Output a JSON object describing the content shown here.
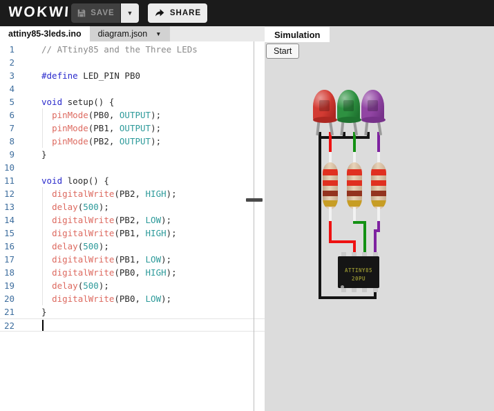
{
  "topbar": {
    "logo": "WOKWI",
    "save_label": "SAVE",
    "share_label": "SHARE"
  },
  "tabs": {
    "file_tab": "attiny85-3leds.ino",
    "diagram_tab": "diagram.json"
  },
  "simulation": {
    "tab_label": "Simulation",
    "start_label": "Start"
  },
  "editor": {
    "cursor": {
      "line": 22,
      "column": 0
    },
    "lines": [
      {
        "n": 1,
        "g": false,
        "tokens": [
          [
            "cm",
            "// ATtiny85 and the Three LEDs"
          ]
        ]
      },
      {
        "n": 2,
        "g": false,
        "tokens": []
      },
      {
        "n": 3,
        "g": false,
        "tokens": [
          [
            "kw",
            "#define"
          ],
          [
            "pl",
            " LED_PIN PB0"
          ]
        ]
      },
      {
        "n": 4,
        "g": false,
        "tokens": []
      },
      {
        "n": 5,
        "g": false,
        "tokens": [
          [
            "kw",
            "void"
          ],
          [
            "pl",
            " setup() {"
          ]
        ]
      },
      {
        "n": 6,
        "g": true,
        "tokens": [
          [
            "pl",
            "  "
          ],
          [
            "fn",
            "pinMode"
          ],
          [
            "pl",
            "(PB0, "
          ],
          [
            "ct",
            "OUTPUT"
          ],
          [
            "pl",
            ");"
          ]
        ]
      },
      {
        "n": 7,
        "g": true,
        "tokens": [
          [
            "pl",
            "  "
          ],
          [
            "fn",
            "pinMode"
          ],
          [
            "pl",
            "(PB1, "
          ],
          [
            "ct",
            "OUTPUT"
          ],
          [
            "pl",
            ");"
          ]
        ]
      },
      {
        "n": 8,
        "g": true,
        "tokens": [
          [
            "pl",
            "  "
          ],
          [
            "fn",
            "pinMode"
          ],
          [
            "pl",
            "(PB2, "
          ],
          [
            "ct",
            "OUTPUT"
          ],
          [
            "pl",
            ");"
          ]
        ]
      },
      {
        "n": 9,
        "g": false,
        "tokens": [
          [
            "pl",
            "}"
          ]
        ]
      },
      {
        "n": 10,
        "g": false,
        "tokens": []
      },
      {
        "n": 11,
        "g": false,
        "tokens": [
          [
            "kw",
            "void"
          ],
          [
            "pl",
            " loop() {"
          ]
        ]
      },
      {
        "n": 12,
        "g": true,
        "tokens": [
          [
            "pl",
            "  "
          ],
          [
            "fn",
            "digitalWrite"
          ],
          [
            "pl",
            "(PB2, "
          ],
          [
            "ct",
            "HIGH"
          ],
          [
            "pl",
            ");"
          ]
        ]
      },
      {
        "n": 13,
        "g": true,
        "tokens": [
          [
            "pl",
            "  "
          ],
          [
            "fn",
            "delay"
          ],
          [
            "pl",
            "("
          ],
          [
            "ct",
            "500"
          ],
          [
            "pl",
            ");"
          ]
        ]
      },
      {
        "n": 14,
        "g": true,
        "tokens": [
          [
            "pl",
            "  "
          ],
          [
            "fn",
            "digitalWrite"
          ],
          [
            "pl",
            "(PB2, "
          ],
          [
            "ct",
            "LOW"
          ],
          [
            "pl",
            ");"
          ]
        ]
      },
      {
        "n": 15,
        "g": true,
        "tokens": [
          [
            "pl",
            "  "
          ],
          [
            "fn",
            "digitalWrite"
          ],
          [
            "pl",
            "(PB1, "
          ],
          [
            "ct",
            "HIGH"
          ],
          [
            "pl",
            ");"
          ]
        ]
      },
      {
        "n": 16,
        "g": true,
        "tokens": [
          [
            "pl",
            "  "
          ],
          [
            "fn",
            "delay"
          ],
          [
            "pl",
            "("
          ],
          [
            "ct",
            "500"
          ],
          [
            "pl",
            ");"
          ]
        ]
      },
      {
        "n": 17,
        "g": true,
        "tokens": [
          [
            "pl",
            "  "
          ],
          [
            "fn",
            "digitalWrite"
          ],
          [
            "pl",
            "(PB1, "
          ],
          [
            "ct",
            "LOW"
          ],
          [
            "pl",
            ");"
          ]
        ]
      },
      {
        "n": 18,
        "g": true,
        "tokens": [
          [
            "pl",
            "  "
          ],
          [
            "fn",
            "digitalWrite"
          ],
          [
            "pl",
            "(PB0, "
          ],
          [
            "ct",
            "HIGH"
          ],
          [
            "pl",
            ");"
          ]
        ]
      },
      {
        "n": 19,
        "g": true,
        "tokens": [
          [
            "pl",
            "  "
          ],
          [
            "fn",
            "delay"
          ],
          [
            "pl",
            "("
          ],
          [
            "ct",
            "500"
          ],
          [
            "pl",
            ");"
          ]
        ]
      },
      {
        "n": 20,
        "g": true,
        "tokens": [
          [
            "pl",
            "  "
          ],
          [
            "fn",
            "digitalWrite"
          ],
          [
            "pl",
            "(PB0, "
          ],
          [
            "ct",
            "LOW"
          ],
          [
            "pl",
            ");"
          ]
        ]
      },
      {
        "n": 21,
        "g": false,
        "tokens": [
          [
            "pl",
            "}"
          ]
        ]
      },
      {
        "n": 22,
        "g": false,
        "tokens": [],
        "cursor": true
      }
    ]
  },
  "circuit": {
    "chip": {
      "label_line1": "ATTINY85",
      "label_line2": "20PU"
    },
    "leds": [
      {
        "id": "led-red",
        "color": "#d33b33",
        "dark": "#ad2822"
      },
      {
        "id": "led-green",
        "color": "#2e9141",
        "dark": "#1f7330"
      },
      {
        "id": "led-purple",
        "color": "#9145a3",
        "dark": "#77328a"
      }
    ],
    "resistors": {
      "count": 3,
      "band_colors": [
        "#e03020",
        "#e03020",
        "#93331f",
        "#c79d24"
      ]
    },
    "wires": {
      "red": "#ee1111",
      "green": "#149114",
      "purple": "#7e22a0",
      "black": "#141414"
    }
  }
}
